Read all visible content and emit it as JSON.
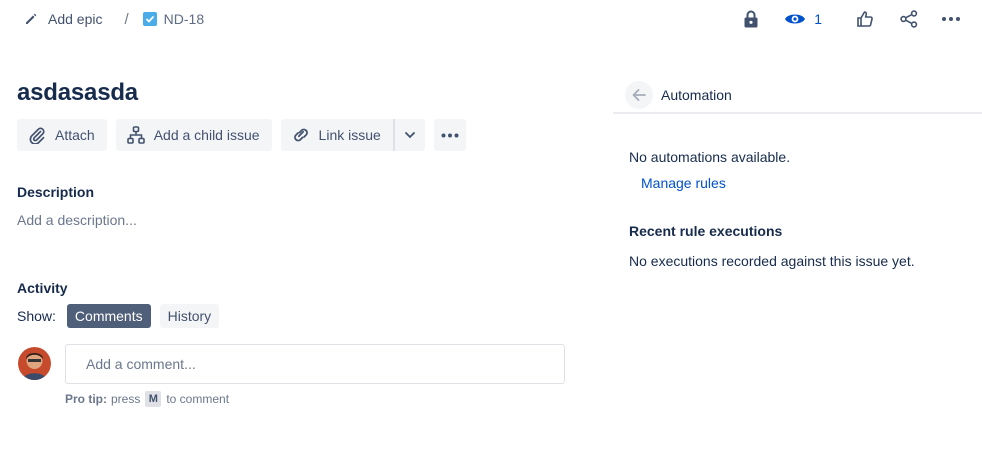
{
  "breadcrumb": {
    "parent_label": "Add epic",
    "separator": "/",
    "issue_key": "ND-18"
  },
  "header_actions": {
    "watch_count": "1",
    "icons": [
      "lock-icon",
      "eye-icon",
      "thumbs-up-icon",
      "share-icon",
      "more-icon"
    ]
  },
  "issue": {
    "title": "asdasasda"
  },
  "toolbar": {
    "attach_label": "Attach",
    "child_label": "Add a child issue",
    "link_label": "Link issue"
  },
  "description": {
    "heading": "Description",
    "placeholder": "Add a description..."
  },
  "activity": {
    "heading": "Activity",
    "show_label": "Show:",
    "tabs": [
      {
        "label": "Comments",
        "active": true
      },
      {
        "label": "History",
        "active": false
      }
    ],
    "comment_placeholder": "Add a comment...",
    "protip_label": "Pro tip:",
    "protip_press": "press",
    "protip_key": "M",
    "protip_suffix": "to comment"
  },
  "automation": {
    "title": "Automation",
    "empty_text": "No automations available.",
    "manage_link": "Manage rules",
    "recent_heading": "Recent rule executions",
    "recent_empty": "No executions recorded against this issue yet."
  },
  "colors": {
    "link": "#0052cc",
    "text": "#172b4d",
    "muted": "#6b778c",
    "active_tab": "#505f79",
    "button_bg": "#f4f5f7",
    "issue_type_check": "#4bade8"
  }
}
